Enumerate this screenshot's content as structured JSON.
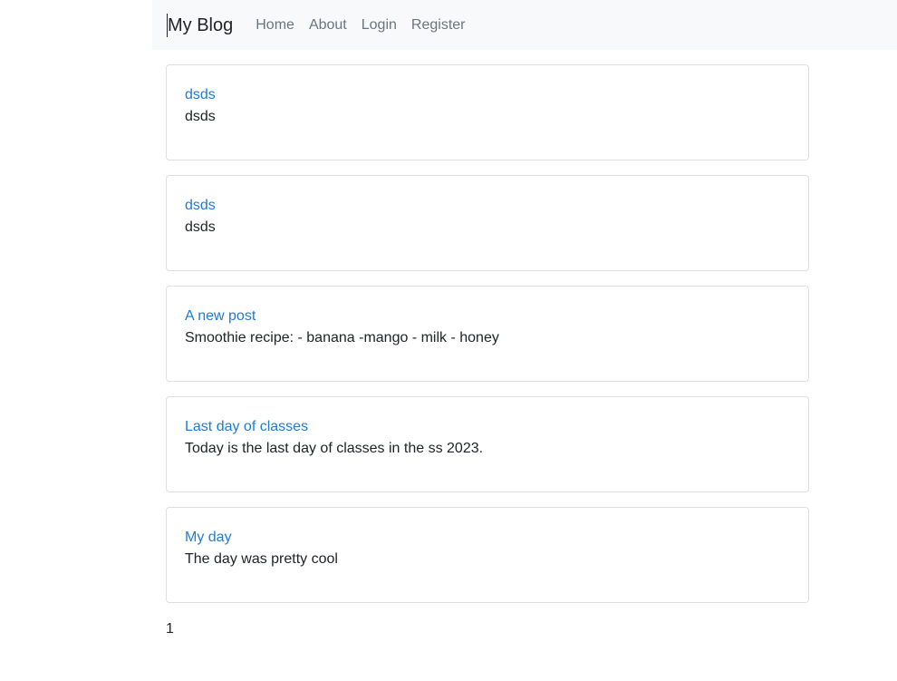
{
  "nav": {
    "brand": "My Blog",
    "links": [
      "Home",
      "About",
      "Login",
      "Register"
    ]
  },
  "posts": [
    {
      "title": "dsds",
      "body": "dsds"
    },
    {
      "title": "dsds",
      "body": "dsds"
    },
    {
      "title": "A new post",
      "body": "Smoothie recipe: - banana -mango - milk - honey"
    },
    {
      "title": "Last day of classes",
      "body": "Today is the last day of classes in the ss 2023."
    },
    {
      "title": "My day",
      "body": "The day was pretty cool"
    }
  ],
  "pagination": {
    "current": "1"
  },
  "colors": {
    "link": "#1e7bd6",
    "navbar_bg": "#f8f9fa",
    "nav_link": "#6c757d"
  }
}
